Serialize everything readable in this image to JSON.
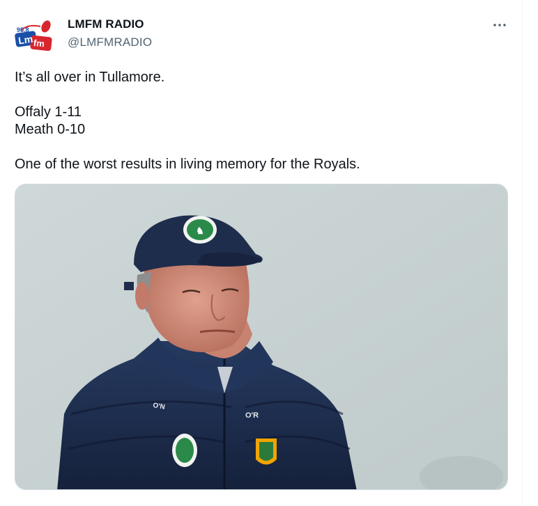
{
  "tweet": {
    "author": {
      "display_name": "LMFM RADIO",
      "handle": "@LMFMRADIO",
      "avatar_text_top": "95.8",
      "avatar_text": "Lm fm"
    },
    "more_icon": "more-horizontal-icon",
    "text_lines": [
      "It’s all over in Tullamore.",
      "",
      "Offaly 1-11",
      "Meath 0-10",
      "",
      "One of the worst results in living memory for the Royals."
    ],
    "media": {
      "type": "photo",
      "jacket_brand": "O'N",
      "jacket_tag": "O'R"
    }
  },
  "colors": {
    "text_primary": "#0f1419",
    "text_secondary": "#536471",
    "border": "#cfd9de",
    "cap_navy": "#1f2d4d",
    "jacket_navy": "#1c2a4a",
    "sky": "#c9d3d3",
    "avatar_red": "#d8262e",
    "avatar_blue": "#1b4fa8"
  }
}
